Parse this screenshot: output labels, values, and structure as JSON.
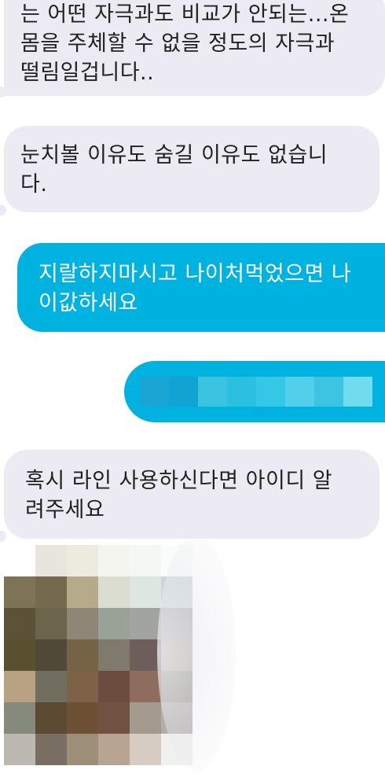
{
  "messages": [
    {
      "id": "m1",
      "side": "incoming",
      "text": "는 어떤 자극과도 비교가 안되는...온\n몸을 주체할 수 없을 정도의 자극과\n떨림일겁니다.."
    },
    {
      "id": "m2",
      "side": "incoming",
      "text": "눈치볼 이유도 숨길 이유도 없습니\n다."
    },
    {
      "id": "m3",
      "side": "outgoing",
      "text": "지랄하지마시고 나이처먹었으면 나\n이값하세요"
    },
    {
      "id": "m4",
      "side": "outgoing",
      "text": "",
      "redacted": true
    },
    {
      "id": "m5",
      "side": "incoming",
      "text": "혹시 라인 사용하신다면 아이디 알\n려주세요"
    }
  ],
  "colors": {
    "incoming_bubble": "#ecebf4",
    "outgoing_bubble": "#00b2df",
    "background": "#ffffff"
  },
  "redacted_bubble_pixels": [
    "#1aa6d4",
    "#11a3d1",
    "#3ac4e0",
    "#2bbfe0",
    "#35c8e6",
    "#52d0eb",
    "#3cc4e2",
    "#70dcee"
  ],
  "photo_pixels": [
    [
      "#ffffff",
      "#e8e6dc",
      "#edeadf",
      "#f4f5ee",
      "#f3f8f2",
      "#f9fcfa"
    ],
    [
      "#7e7455",
      "#756a4e",
      "#b5ab8b",
      "#dcddd1",
      "#dde6e1",
      "#cdd8d9"
    ],
    [
      "#5c5237",
      "#6d654b",
      "#8f8776",
      "#9aa197",
      "#a2a4a2",
      "#b1b3ae"
    ],
    [
      "#59502f",
      "#514937",
      "#746445",
      "#7f7a6c",
      "#6c5f5a",
      "#b8aea3"
    ],
    [
      "#b7a382",
      "#6f6e5f",
      "#7e6248",
      "#6a4d3e",
      "#8e6c5e",
      "#9c9a8c"
    ],
    [
      "#858a7c",
      "#5d4a33",
      "#6e5035",
      "#6f5242",
      "#a59a8e",
      "#b2adaa"
    ],
    [
      "#bcb9b2",
      "#7a6d62",
      "#9d8e78",
      "#b8a493",
      "#d6ccc2",
      "#f0f0ee"
    ]
  ]
}
